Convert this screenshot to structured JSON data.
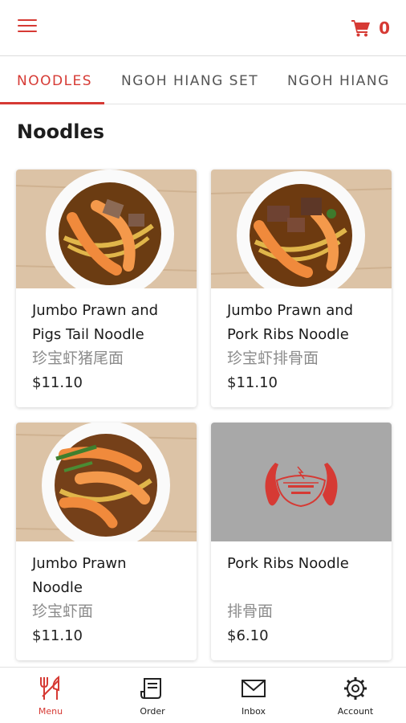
{
  "header": {
    "menu_icon": "hamburger-icon",
    "cart_icon": "shopping-cart-icon",
    "cart_count": "0"
  },
  "tabs": [
    {
      "label": "NOODLES",
      "active": true
    },
    {
      "label": "NGOH HIANG SET",
      "active": false
    },
    {
      "label": "NGOH HIANG",
      "active": false
    }
  ],
  "section": {
    "title": "Noodles"
  },
  "products": [
    {
      "name": "Jumbo Prawn and Pigs Tail Noodle",
      "name_cn": "珍宝虾猪尾面",
      "price": "$11.10",
      "image": "prawn-pigs-tail-noodle-photo"
    },
    {
      "name": "Jumbo Prawn and Pork Ribs Noodle",
      "name_cn": "珍宝虾排骨面",
      "price": "$11.10",
      "image": "prawn-pork-ribs-noodle-photo"
    },
    {
      "name": "Jumbo Prawn Noodle",
      "name_cn": "珍宝虾面",
      "price": "$11.10",
      "image": "prawn-noodle-photo"
    },
    {
      "name": "Pork Ribs Noodle",
      "name_cn": "排骨面",
      "price": "$6.10",
      "image": "placeholder-logo-image"
    }
  ],
  "bottom_nav": [
    {
      "label": "Menu",
      "icon": "fork-knife-icon",
      "active": true
    },
    {
      "label": "Order",
      "icon": "receipt-icon",
      "active": false
    },
    {
      "label": "Inbox",
      "icon": "envelope-icon",
      "active": false
    },
    {
      "label": "Account",
      "icon": "gear-icon",
      "active": false
    }
  ],
  "colors": {
    "accent": "#d63a34",
    "placeholder_bg": "#a8a8a8",
    "wood_bg": "#dcc3a6"
  }
}
